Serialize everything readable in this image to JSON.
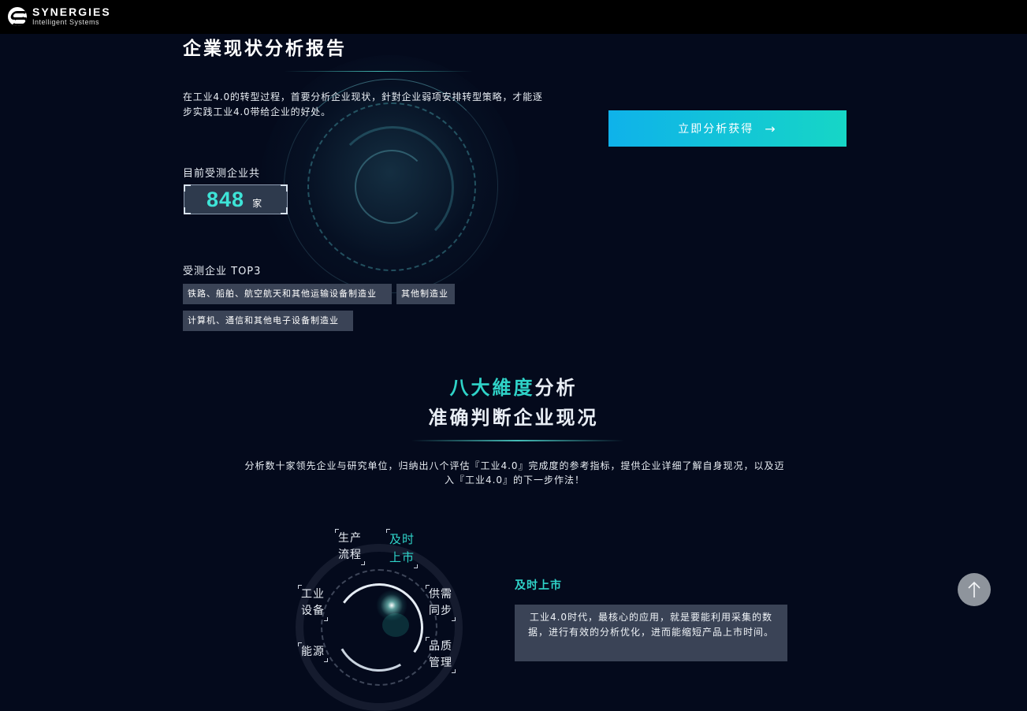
{
  "brand": {
    "name": "SYNERGIES",
    "tagline": "Intelligent Systems"
  },
  "report": {
    "title": "企業现状分析报告",
    "intro": "在工业4.0的转型过程，首要分析企业现状，針對企业弱项安排转型策略，才能逐步实践工业4.0带给企业的好处。",
    "cta_label": "立即分析获得",
    "cta_icon": "arrow-right-icon",
    "count_label": "目前受测企业共",
    "count_value": "848",
    "count_unit": "家",
    "top3_label": "受测企业 TOP3",
    "top3": [
      "铁路、船舶、航空航天和其他运输设备制造业",
      "其他制造业",
      "计算机、通信和其他电子设备制造业"
    ]
  },
  "dimensions": {
    "title_accent": "八大維度",
    "title_rest": "分析",
    "subtitle": "准确判断企业现况",
    "description": "分析数十家领先企业与研究单位，归纳出八个评估『工业4.0』完成度的参考指标，提供企业详细了解自身现况，以及迈入『工业4.0』的下一步作法！",
    "items": [
      {
        "line1": "生产",
        "line2": "流程"
      },
      {
        "line1": "及时",
        "line2": "上市"
      },
      {
        "line1": "工业",
        "line2": "设备"
      },
      {
        "line1": "供需",
        "line2": "同步"
      },
      {
        "line1": "能源",
        "line2": ""
      },
      {
        "line1": "品质",
        "line2": "管理"
      }
    ],
    "active_index": 1,
    "detail_title": "及时上市",
    "detail_text": "工业4.0时代，最核心的应用，就是要能利用采集的数据，进行有效的分析优化，进而能缩短产品上市时间。"
  },
  "back_to_top_icon": "arrow-up-icon",
  "colors": {
    "accent": "#2fd3c8",
    "cta_start": "#0fb2ea",
    "cta_end": "#16d6c6",
    "background": "#040a1c"
  }
}
